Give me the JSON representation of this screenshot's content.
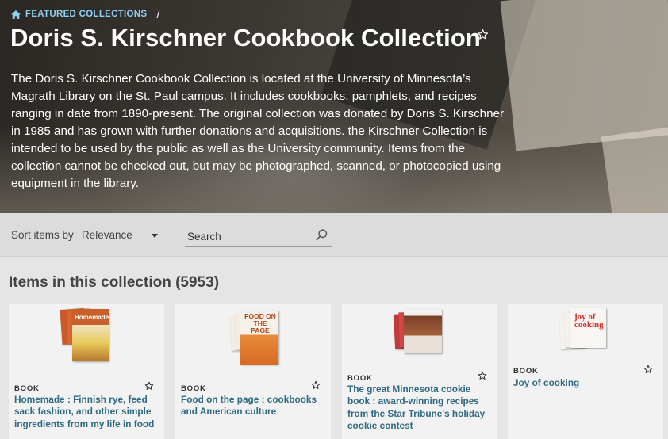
{
  "breadcrumb": {
    "link_label": "FEATURED COLLECTIONS",
    "separator": "/"
  },
  "page_title": "Doris S. Kirschner Cookbook Collection",
  "description": "The Doris S. Kirschner Cookbook Collection is located at the University of Minnesota’s Magrath Library on the St. Paul campus. It includes cookbooks, pamphlets, and recipes ranging in date from 1890-present. The original collection was donated by Doris S. Kirschner in 1985 and has grown with further donations and acquisitions. the Kirschner Collection is intended to be used by the public as well as the University community. Items from the collection cannot be checked out, but may be photographed, scanned, or photocopied using equipment in the library.",
  "toolbar": {
    "sort_label": "Sort items by",
    "sort_value": "Relevance",
    "search_placeholder": "Search"
  },
  "section_title": "Items in this collection (5953)",
  "items": [
    {
      "type": "BOOK",
      "title": "Homemade : Finnish rye, feed sack fashion, and other simple ingredients from my life in food",
      "cover_text": "Homemade"
    },
    {
      "type": "BOOK",
      "title": "Food on the page : cookbooks and American culture",
      "cover_text": "FOOD ON THE PAGE"
    },
    {
      "type": "BOOK",
      "title": "The great Minnesota cookie book : award-winning recipes from the Star Tribune's holiday cookie contest",
      "cover_text": ""
    },
    {
      "type": "BOOK",
      "title": "Joy of cooking",
      "cover_text": "joy of cooking"
    }
  ],
  "colors": {
    "link": "#2e6a83",
    "breadcrumb": "#8fd0f2",
    "toolbar_bg": "#dcdcdc",
    "page_bg": "#e5e5e5"
  }
}
